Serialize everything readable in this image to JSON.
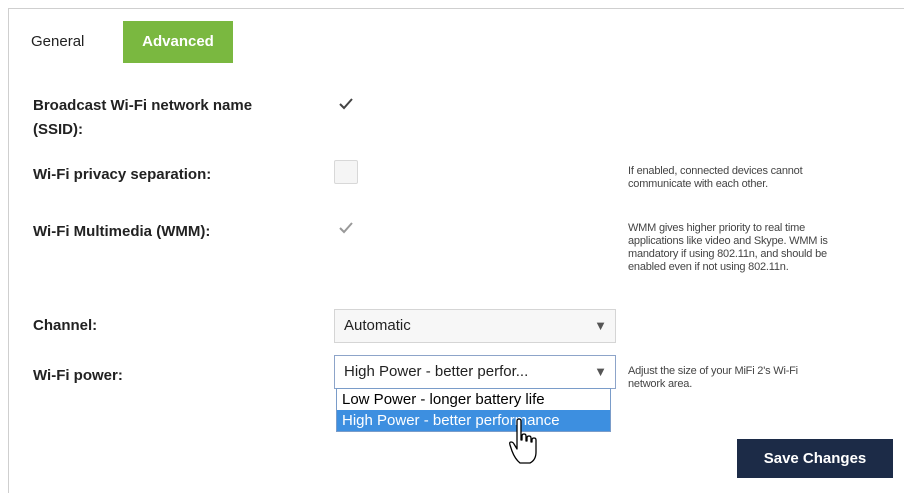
{
  "tabs": {
    "general": "General",
    "advanced": "Advanced"
  },
  "settings": {
    "broadcast_ssid": {
      "label_line1": "Broadcast Wi-Fi network name",
      "label_line2": "(SSID):",
      "checked": true
    },
    "privacy_separation": {
      "label": "Wi-Fi privacy separation:",
      "checked": false,
      "help_line1": "If enabled, connected devices cannot",
      "help_line2": "communicate with each other."
    },
    "wmm": {
      "label": "Wi-Fi Multimedia (WMM):",
      "checked": true,
      "help_line1": "WMM gives higher priority to real time",
      "help_line2": "applications like video and Skype. WMM is",
      "help_line3": "mandatory if using 802.11n, and should be",
      "help_line4": "enabled even if not using 802.11n."
    },
    "channel": {
      "label": "Channel:",
      "value": "Automatic"
    },
    "wifi_power": {
      "label": "Wi-Fi power:",
      "value": "High Power - better perfor...",
      "help_line1": "Adjust the size of your MiFi 2's Wi-Fi",
      "help_line2": "network area.",
      "options": [
        "Low Power - longer battery life",
        "High Power - better performance"
      ],
      "highlighted": "High Power - better performance"
    }
  },
  "actions": {
    "save": "Save Changes"
  },
  "colors": {
    "accent_green": "#7ab840",
    "save_navy": "#1c2b47",
    "highlight_blue": "#3d8fe0"
  }
}
